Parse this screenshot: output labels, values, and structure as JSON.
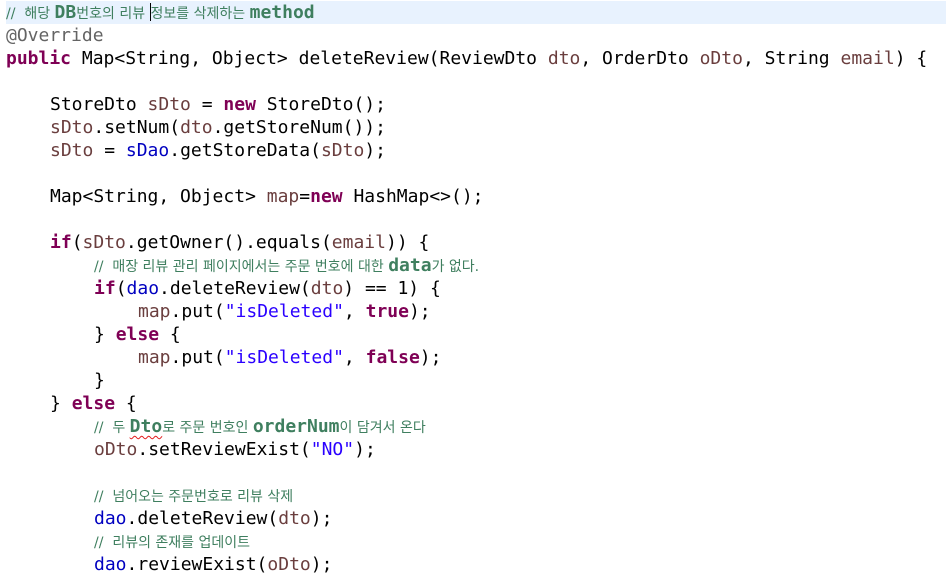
{
  "code": {
    "comment_header_a": "//  해당 ",
    "comment_header_b": "DB",
    "comment_header_c": "번호의 리뷰 ",
    "comment_header_d": "정보를 삭제하는 ",
    "comment_header_e": "method",
    "annotation": "@Override",
    "sig_public": "public",
    "sig_rest_a": " Map<String, Object> deleteReview(ReviewDto ",
    "sig_dto": "dto",
    "sig_rest_b": ", OrderDto ",
    "sig_odto": "oDto",
    "sig_rest_c": ", String ",
    "sig_email": "email",
    "sig_rest_d": ") {",
    "l1_a": "StoreDto ",
    "l1_sdto": "sDto",
    "l1_b": " = ",
    "l1_new": "new",
    "l1_c": " StoreDto();",
    "l2_sdto": "sDto",
    "l2_a": ".setNum(",
    "l2_dto": "dto",
    "l2_b": ".getStoreNum());",
    "l3_sdto": "sDto",
    "l3_a": " = ",
    "l3_sdao": "sDao",
    "l3_b": ".getStoreData(",
    "l3_sdto2": "sDto",
    "l3_c": ");",
    "l4_a": "Map<String, Object> ",
    "l4_map": "map",
    "l4_b": "=",
    "l4_new": "new",
    "l4_c": " HashMap<>();",
    "l5_if": "if",
    "l5_a": "(",
    "l5_sdto": "sDto",
    "l5_b": ".getOwner().equals(",
    "l5_email": "email",
    "l5_c": ")) {",
    "c2_a": "//  매장 리뷰 관리 페이지에서는 주문 번호에 대한 ",
    "c2_b": "data",
    "c2_c": "가 없다.",
    "l6_if": "if",
    "l6_a": "(",
    "l6_dao": "dao",
    "l6_b": ".deleteReview(",
    "l6_dto": "dto",
    "l6_c": ") == 1) {",
    "l7_map": "map",
    "l7_a": ".put(",
    "l7_str": "\"isDeleted\"",
    "l7_b": ", ",
    "l7_true": "true",
    "l7_c": ");",
    "l8_a": "} ",
    "l8_else": "else",
    "l8_b": " {",
    "l9_map": "map",
    "l9_a": ".put(",
    "l9_str": "\"isDeleted\"",
    "l9_b": ", ",
    "l9_false": "false",
    "l9_c": ");",
    "l10": "}",
    "l11_a": "} ",
    "l11_else": "else",
    "l11_b": " {",
    "c3_a": "//  두 ",
    "c3_b": "Dto",
    "c3_c": "로 주문 번호인 ",
    "c3_d": "orderNum",
    "c3_e": "이 담겨서 온다",
    "l12_odto": "oDto",
    "l12_a": ".setReviewExist(",
    "l12_str": "\"NO\"",
    "l12_b": ");",
    "c4": "//  넘어오는 주문번호로 리뷰 삭제",
    "l13_dao": "dao",
    "l13_a": ".deleteReview(",
    "l13_dto": "dto",
    "l13_b": ");",
    "c5": "//  리뷰의 존재를 업데이트",
    "l14_dao": "dao",
    "l14_a": ".reviewExist(",
    "l14_odto": "oDto",
    "l14_b": ");"
  },
  "colors": {
    "keyword": "#7f0055",
    "comment": "#3f7f5f",
    "annotation": "#646464",
    "local_variable": "#6a3e3e",
    "field": "#0000c0",
    "string": "#2a00ff",
    "current_line": "#e8f2fe"
  }
}
